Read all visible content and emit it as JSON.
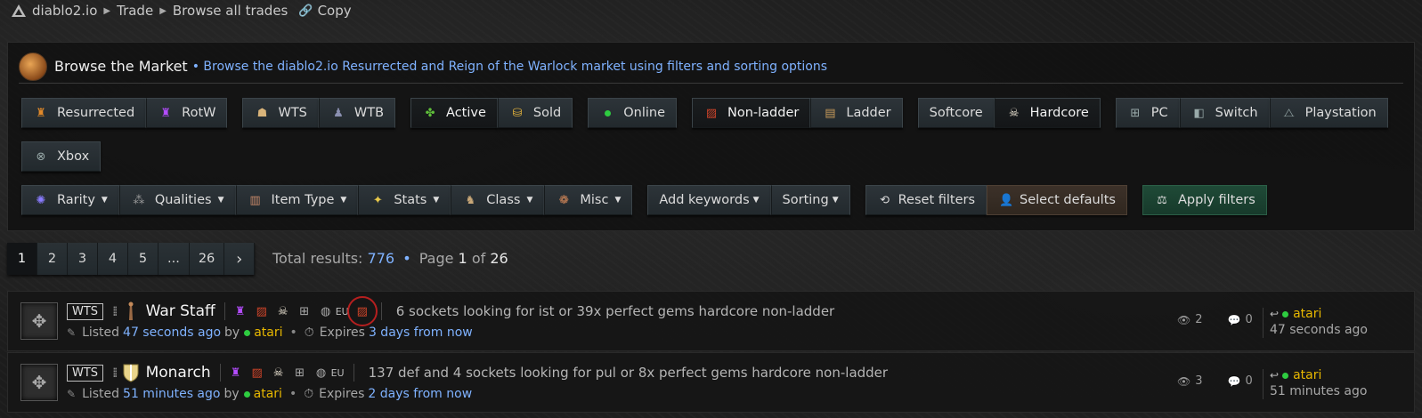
{
  "breadcrumb": {
    "site": "diablo2.io",
    "trade": "Trade",
    "browse": "Browse all trades",
    "copy": "Copy"
  },
  "panel": {
    "title": "Browse the Market",
    "subtitle": "• Browse the diablo2.io Resurrected and Reign of the Warlock market using filters and sorting options"
  },
  "filters": {
    "resurrected": "Resurrected",
    "rotw": "RotW",
    "wts": "WTS",
    "wtb": "WTB",
    "active": "Active",
    "sold": "Sold",
    "online": "Online",
    "nonladder": "Non-ladder",
    "ladder": "Ladder",
    "softcore": "Softcore",
    "hardcore": "Hardcore",
    "pc": "PC",
    "switch": "Switch",
    "playstation": "Playstation",
    "xbox": "Xbox"
  },
  "dropdowns": {
    "rarity": "Rarity",
    "qualities": "Qualities",
    "item_type": "Item Type",
    "stats": "Stats",
    "class": "Class",
    "misc": "Misc",
    "add_keywords": "Add keywords",
    "sorting": "Sorting"
  },
  "actions": {
    "reset": "Reset filters",
    "select_defaults": "Select defaults",
    "apply": "Apply filters"
  },
  "pagination": {
    "pages": [
      "1",
      "2",
      "3",
      "4",
      "5",
      "...",
      "26"
    ],
    "current": "1",
    "next": "›"
  },
  "totals": {
    "label": "Total results:",
    "count": "776",
    "page_label": "Page",
    "page": "1",
    "of": "of",
    "total_pages": "26"
  },
  "listings": [
    {
      "tag": "WTS",
      "name": "War Staff",
      "region": "EU",
      "description": "6 sockets looking for ist or 39x perfect gems hardcore non-ladder",
      "listed_label": "Listed",
      "listed_time": "47 seconds ago",
      "by": "by",
      "user": "atari",
      "expires_label": "Expires",
      "expires_time": "3 days from now",
      "views": "2",
      "replies": "0",
      "last_user": "atari",
      "last_time": "47 seconds ago"
    },
    {
      "tag": "WTS",
      "name": "Monarch",
      "region": "EU",
      "description": "137 def and 4 sockets looking for pul or 8x perfect gems hardcore non-ladder",
      "listed_label": "Listed",
      "listed_time": "51 minutes ago",
      "by": "by",
      "user": "atari",
      "expires_label": "Expires",
      "expires_time": "2 days from now",
      "views": "3",
      "replies": "0",
      "last_user": "atari",
      "last_time": "51 minutes ago"
    }
  ],
  "colors": {
    "accent_blue": "#7fb2ff",
    "username_gold": "#e8b800",
    "online_green": "#2ecc40",
    "apply_green": "#1f4a37"
  }
}
